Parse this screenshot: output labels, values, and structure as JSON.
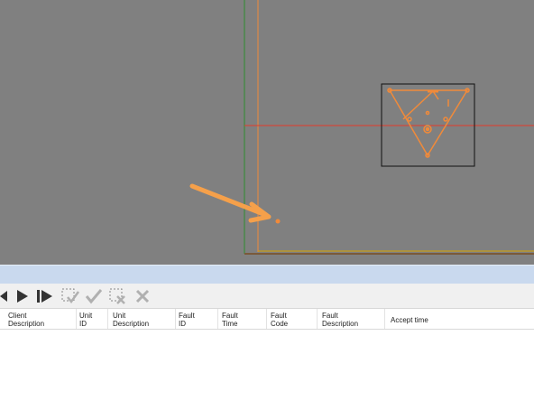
{
  "toolbar": {
    "buttons": [
      {
        "icon": "step-back-icon"
      },
      {
        "icon": "play-icon"
      },
      {
        "icon": "step-forward-icon"
      },
      {
        "icon": "select-accept-icon"
      },
      {
        "icon": "accept-check-icon"
      },
      {
        "icon": "select-reject-icon"
      },
      {
        "icon": "reject-x-icon"
      }
    ]
  },
  "table": {
    "columns": [
      {
        "label": "Client\nDescription"
      },
      {
        "label": "Unit\nID"
      },
      {
        "label": "Unit\nDescription"
      },
      {
        "label": "Fault\nID"
      },
      {
        "label": "Fault\nTime"
      },
      {
        "label": "Fault\nCode"
      },
      {
        "label": "Fault\nDescription"
      },
      {
        "label": "Accept time"
      }
    ],
    "rows": []
  },
  "colors": {
    "canvas_bg": "#808080",
    "accent_orange": "#f08a3a",
    "crosshair_red": "#e43a2a",
    "axis_green": "#2e8b2e",
    "check_gray": "#b0b0b0"
  }
}
